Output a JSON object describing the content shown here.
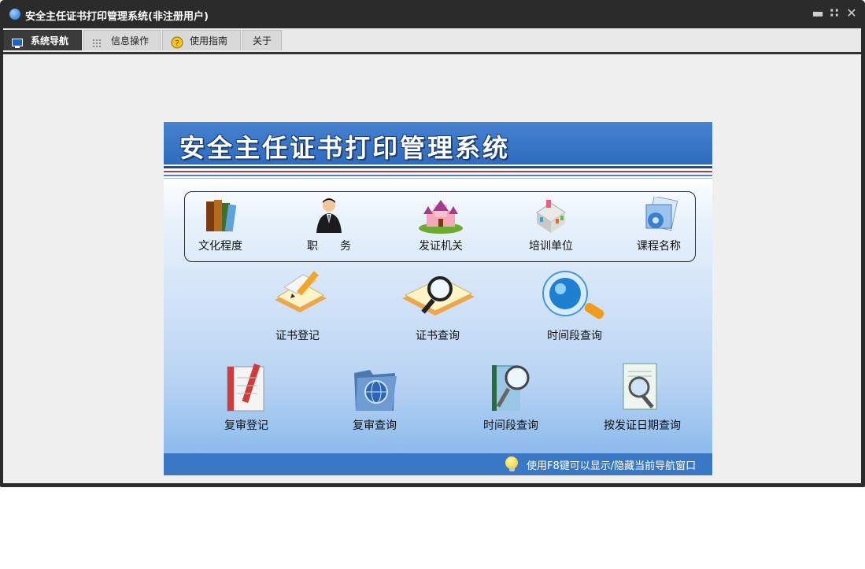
{
  "window": {
    "title": "安全主任证书打印管理系统(非注册用户)"
  },
  "controls": {
    "minimize": "▁",
    "restore": "⁝",
    "close": "✕"
  },
  "tabs": [
    {
      "label": "系统导航",
      "icon": "monitor-icon"
    },
    {
      "label": "信息操作",
      "icon": "grid-icon"
    },
    {
      "label": "使用指南",
      "icon": "help-icon"
    },
    {
      "label": "关于"
    }
  ],
  "banner": {
    "title": "安全主任证书打印管理系统"
  },
  "basic_items": [
    {
      "label": "文化程度",
      "icon": "books-icon"
    },
    {
      "label": "职　　务",
      "icon": "person-icon"
    },
    {
      "label": "发证机关",
      "icon": "castle-icon"
    },
    {
      "label": "培训单位",
      "icon": "building-icon"
    },
    {
      "label": "课程名称",
      "icon": "folder-gear-icon"
    }
  ],
  "cert_items": [
    {
      "label": "证书登记",
      "icon": "edit-paper-icon"
    },
    {
      "label": "证书查询",
      "icon": "magnifier-book-icon"
    },
    {
      "label": "时间段查询",
      "icon": "magnifier-icon"
    }
  ],
  "review_items": [
    {
      "label": "复审登记",
      "icon": "notebook-icon"
    },
    {
      "label": "复审查询",
      "icon": "globe-folder-icon"
    },
    {
      "label": "时间段查询",
      "icon": "binder-search-icon"
    },
    {
      "label": "按发证日期查询",
      "icon": "document-search-icon"
    }
  ],
  "status": {
    "hint": "使用F8键可以显示/隐藏当前导航窗口"
  },
  "colors": {
    "banner": "#3a78c5",
    "frame": "#2b2b2b",
    "content": "#efefef"
  }
}
